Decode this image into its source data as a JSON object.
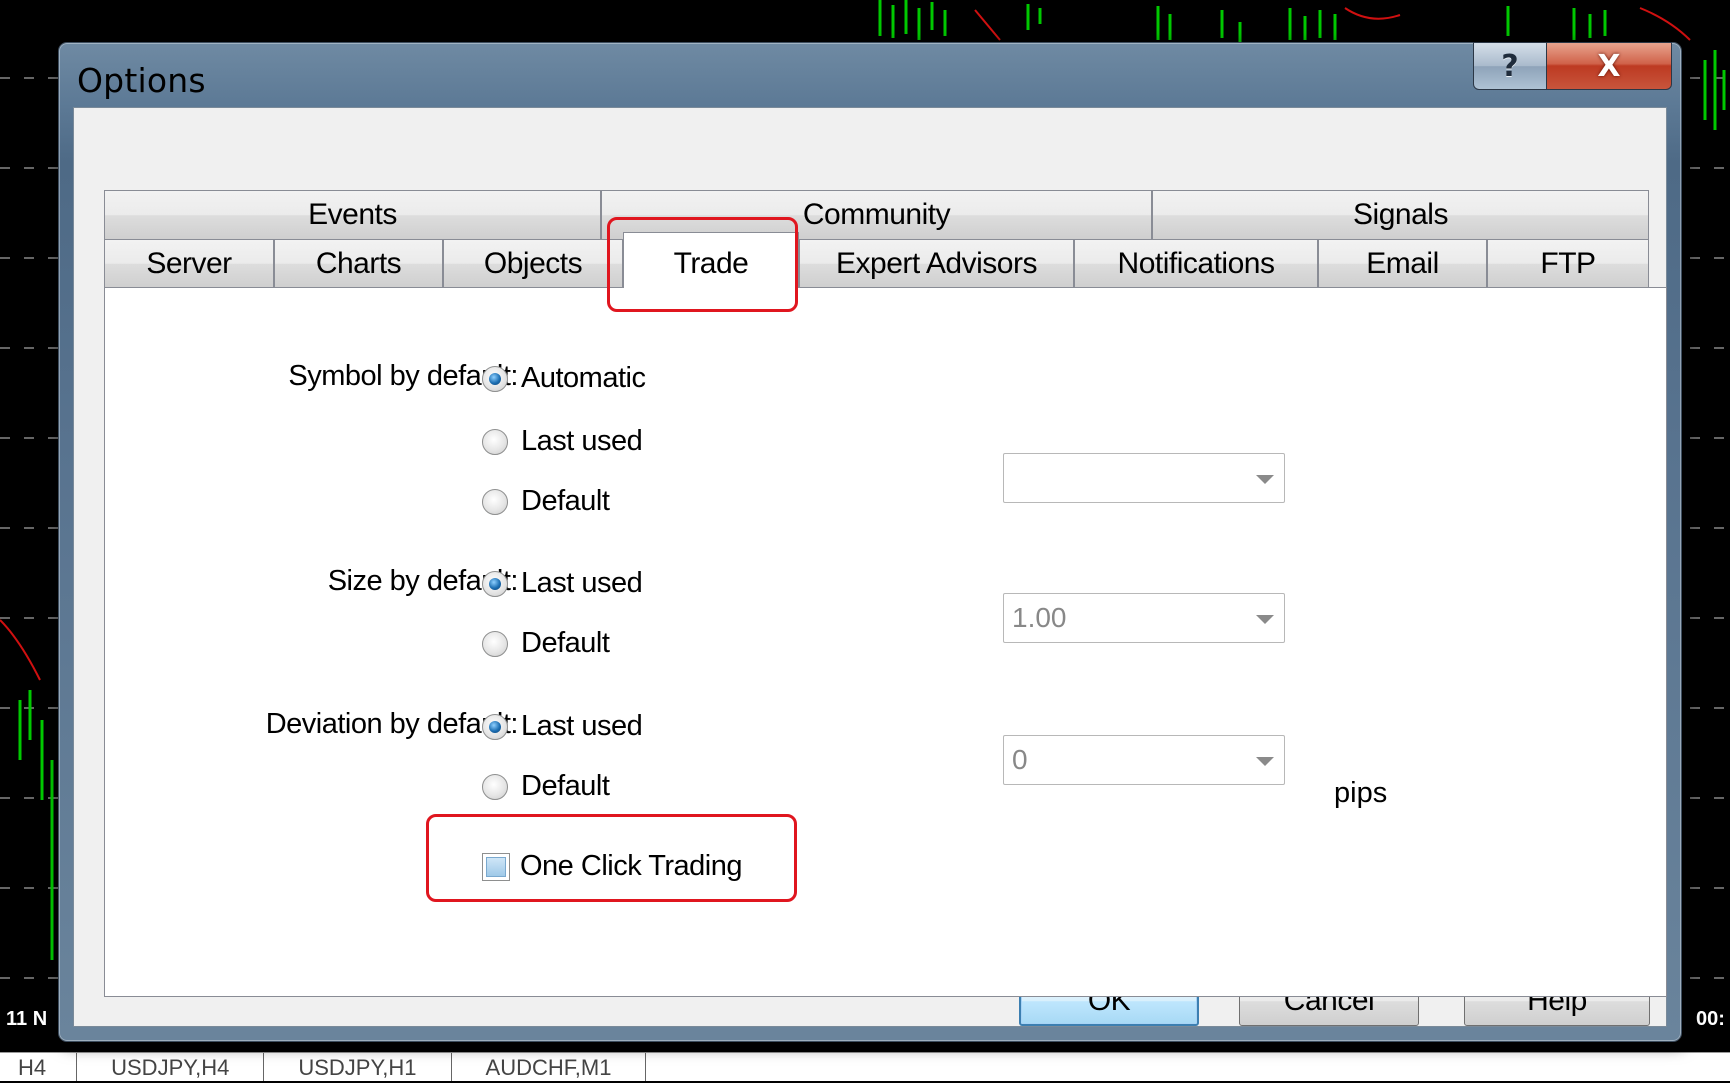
{
  "window": {
    "title": "Options",
    "help_symbol": "?",
    "close_symbol": "X"
  },
  "tabs": {
    "top_row": [
      "Events",
      "Community",
      "Signals"
    ],
    "bottom_row": [
      "Server",
      "Charts",
      "Objects",
      "Trade",
      "Expert Advisors",
      "Notifications",
      "Email",
      "FTP"
    ],
    "active": "Trade"
  },
  "trade": {
    "symbol_label": "Symbol by default:",
    "symbol_options": [
      "Automatic",
      "Last used",
      "Default"
    ],
    "symbol_selected": "Automatic",
    "symbol_combo_value": "",
    "size_label": "Size by default:",
    "size_options": [
      "Last used",
      "Default"
    ],
    "size_selected": "Last used",
    "size_combo_value": "1.00",
    "deviation_label": "Deviation by default:",
    "deviation_options": [
      "Last used",
      "Default"
    ],
    "deviation_selected": "Last used",
    "deviation_combo_value": "0",
    "deviation_unit": "pips",
    "one_click_label": "One Click Trading",
    "one_click_checked": false
  },
  "buttons": {
    "ok": "OK",
    "cancel": "Cancel",
    "help": "Help"
  },
  "background": {
    "left_axis_label": "11 N",
    "right_axis_label": "00:",
    "chart_tabs": [
      "H4",
      "USDJPY,H4",
      "USDJPY,H1",
      "AUDCHF,M1"
    ]
  },
  "colors": {
    "highlight": "#e0161f",
    "bull_bar": "#00c800",
    "ma_line": "#d01010"
  }
}
